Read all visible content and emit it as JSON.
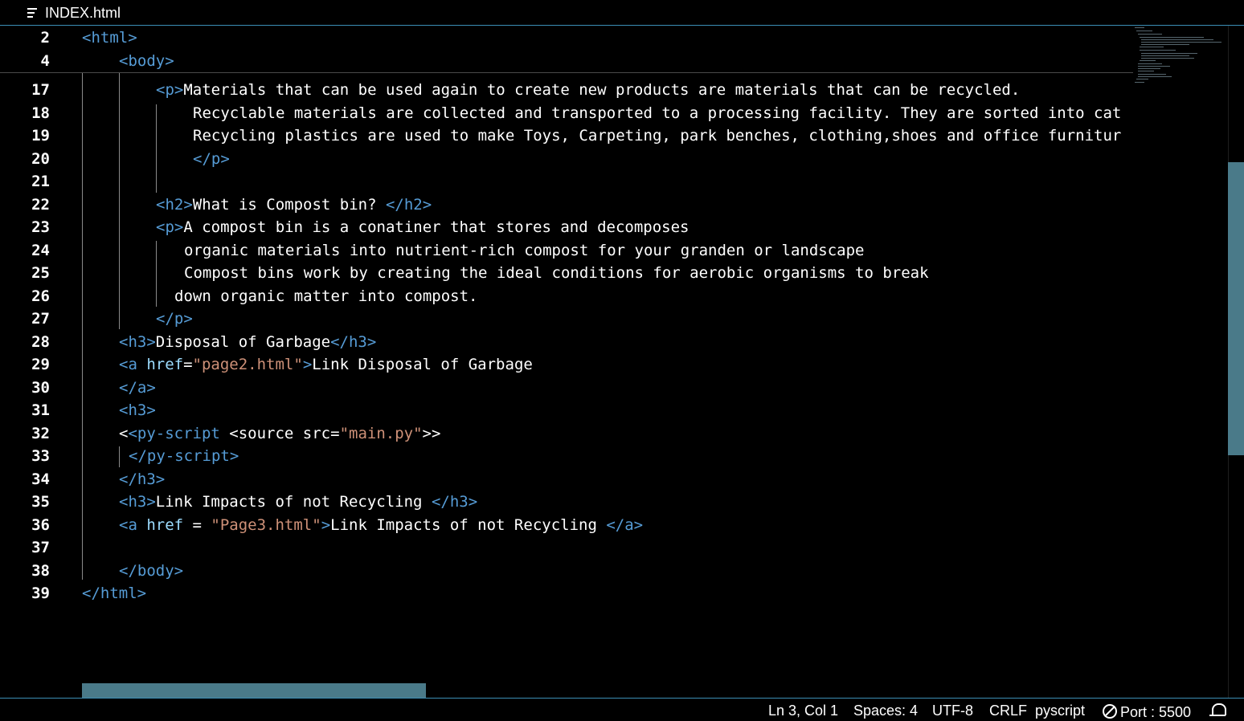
{
  "tab": {
    "icon": "hamburger-menu-icon",
    "title": "INDEX.html"
  },
  "sticky": [
    {
      "n": "2",
      "tokens": [
        [
          "tag",
          "<html>"
        ]
      ]
    },
    {
      "n": "4",
      "tokens": [
        [
          "tag",
          "<body>"
        ]
      ]
    }
  ],
  "lines": [
    {
      "n": "17",
      "tokens": [
        [
          "tag",
          "<p>"
        ],
        [
          "txt",
          "Materials that can be used again to create new products are materials that can be recycled."
        ]
      ]
    },
    {
      "n": "18",
      "tokens": [
        [
          "txt",
          "Recyclable materials are collected and transported to a processing facility. They are sorted into cat"
        ]
      ]
    },
    {
      "n": "19",
      "tokens": [
        [
          "txt",
          "Recycling plastics are used to make Toys, Carpeting, park benches, clothing,shoes and office furnitur"
        ]
      ]
    },
    {
      "n": "20",
      "tokens": [
        [
          "tag",
          "</p>"
        ]
      ]
    },
    {
      "n": "21",
      "tokens": []
    },
    {
      "n": "22",
      "tokens": [
        [
          "tag",
          "<h2>"
        ],
        [
          "txt",
          "What is Compost bin? "
        ],
        [
          "tag",
          "</h2>"
        ]
      ]
    },
    {
      "n": "23",
      "tokens": [
        [
          "tag",
          "<p>"
        ],
        [
          "txt",
          "A compost bin is a conatiner that stores and decomposes"
        ]
      ]
    },
    {
      "n": "24",
      "tokens": [
        [
          "txt",
          "organic materials into nutrient-rich compost for your granden or landscape"
        ]
      ]
    },
    {
      "n": "25",
      "tokens": [
        [
          "txt",
          "Compost bins work by creating the ideal conditions for aerobic organisms to break"
        ]
      ]
    },
    {
      "n": "26",
      "tokens": [
        [
          "txt",
          "down organic matter into compost."
        ]
      ]
    },
    {
      "n": "27",
      "tokens": [
        [
          "tag",
          "</p>"
        ]
      ]
    },
    {
      "n": "28",
      "tokens": [
        [
          "tag",
          "<h3>"
        ],
        [
          "txt",
          "Disposal of Garbage"
        ],
        [
          "tag",
          "</h3>"
        ]
      ]
    },
    {
      "n": "29",
      "tokens": [
        [
          "tag",
          "<a "
        ],
        [
          "attr",
          "href"
        ],
        [
          "txt",
          "="
        ],
        [
          "str",
          "\"page2.html\""
        ],
        [
          "tag",
          ">"
        ],
        [
          "txt",
          "Link Disposal of Garbage"
        ]
      ]
    },
    {
      "n": "30",
      "tokens": [
        [
          "tag",
          "</a>"
        ]
      ]
    },
    {
      "n": "31",
      "tokens": [
        [
          "tag",
          "<h3>"
        ]
      ]
    },
    {
      "n": "32",
      "tokens": [
        [
          "txt",
          "<"
        ],
        [
          "tag",
          "<py-script "
        ],
        [
          "txt",
          "<source src="
        ],
        [
          "str",
          "\"main.py\""
        ],
        [
          "txt",
          ">>"
        ]
      ]
    },
    {
      "n": "33",
      "tokens": [
        [
          "tag",
          "</py-script>"
        ]
      ]
    },
    {
      "n": "34",
      "tokens": [
        [
          "tag",
          "</h3>"
        ]
      ]
    },
    {
      "n": "35",
      "tokens": [
        [
          "tag",
          "<h3>"
        ],
        [
          "txt",
          "Link Impacts of not Recycling "
        ],
        [
          "tag",
          "</h3>"
        ]
      ]
    },
    {
      "n": "36",
      "tokens": [
        [
          "tag",
          "<a "
        ],
        [
          "attr",
          "href"
        ],
        [
          "txt",
          " = "
        ],
        [
          "str",
          "\"Page3.html\""
        ],
        [
          "tag",
          ">"
        ],
        [
          "txt",
          "Link Impacts of not Recycling "
        ],
        [
          "tag",
          "</a>"
        ]
      ]
    },
    {
      "n": "37",
      "tokens": []
    },
    {
      "n": "38",
      "tokens": [
        [
          "tag",
          "</body>"
        ]
      ]
    },
    {
      "n": "39",
      "tokens": [
        [
          "tag",
          "</html>"
        ]
      ]
    }
  ],
  "status": {
    "position": "Ln 3, Col 1",
    "spaces": "Spaces: 4",
    "encoding": "UTF-8",
    "eol": "CRLF",
    "language": "pyscript",
    "port": "Port : 5500",
    "port_icon": "no-entry-circle-icon",
    "bell_icon": "bell-icon"
  }
}
